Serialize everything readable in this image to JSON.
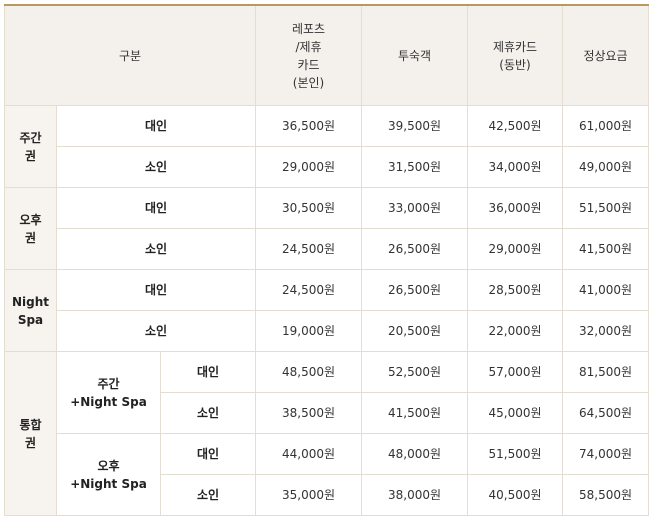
{
  "header": {
    "category": "구분",
    "col_leports": [
      "레포츠",
      "/제휴",
      "카드",
      "(본인)"
    ],
    "col_guest": "투숙객",
    "col_partner": [
      "제휴카드",
      "(동반)"
    ],
    "col_regular": "정상요금"
  },
  "groups": [
    {
      "name": [
        "주간",
        "권"
      ],
      "rows": [
        {
          "type": "대인",
          "prices": [
            "36,500원",
            "39,500원",
            "42,500원",
            "61,000원"
          ]
        },
        {
          "type": "소인",
          "prices": [
            "29,000원",
            "31,500원",
            "34,000원",
            "49,000원"
          ]
        }
      ]
    },
    {
      "name": [
        "오후",
        "권"
      ],
      "rows": [
        {
          "type": "대인",
          "prices": [
            "30,500원",
            "33,000원",
            "36,000원",
            "51,500원"
          ]
        },
        {
          "type": "소인",
          "prices": [
            "24,500원",
            "26,500원",
            "29,000원",
            "41,500원"
          ]
        }
      ]
    },
    {
      "name": [
        "Night",
        "Spa"
      ],
      "rows": [
        {
          "type": "대인",
          "prices": [
            "24,500원",
            "26,500원",
            "28,500원",
            "41,000원"
          ]
        },
        {
          "type": "소인",
          "prices": [
            "19,000원",
            "20,500원",
            "22,000원",
            "32,000원"
          ]
        }
      ]
    }
  ],
  "combo": {
    "name": [
      "통합",
      "권"
    ],
    "subs": [
      {
        "name": [
          "주간",
          "+Night Spa"
        ],
        "rows": [
          {
            "type": "대인",
            "prices": [
              "48,500원",
              "52,500원",
              "57,000원",
              "81,500원"
            ]
          },
          {
            "type": "소인",
            "prices": [
              "38,500원",
              "41,500원",
              "45,000원",
              "64,500원"
            ]
          }
        ]
      },
      {
        "name": [
          "오후",
          "+Night Spa"
        ],
        "rows": [
          {
            "type": "대인",
            "prices": [
              "44,000원",
              "48,000원",
              "51,500원",
              "74,000원"
            ]
          },
          {
            "type": "소인",
            "prices": [
              "35,000원",
              "38,000원",
              "40,500원",
              "58,500원"
            ]
          }
        ]
      }
    ]
  }
}
